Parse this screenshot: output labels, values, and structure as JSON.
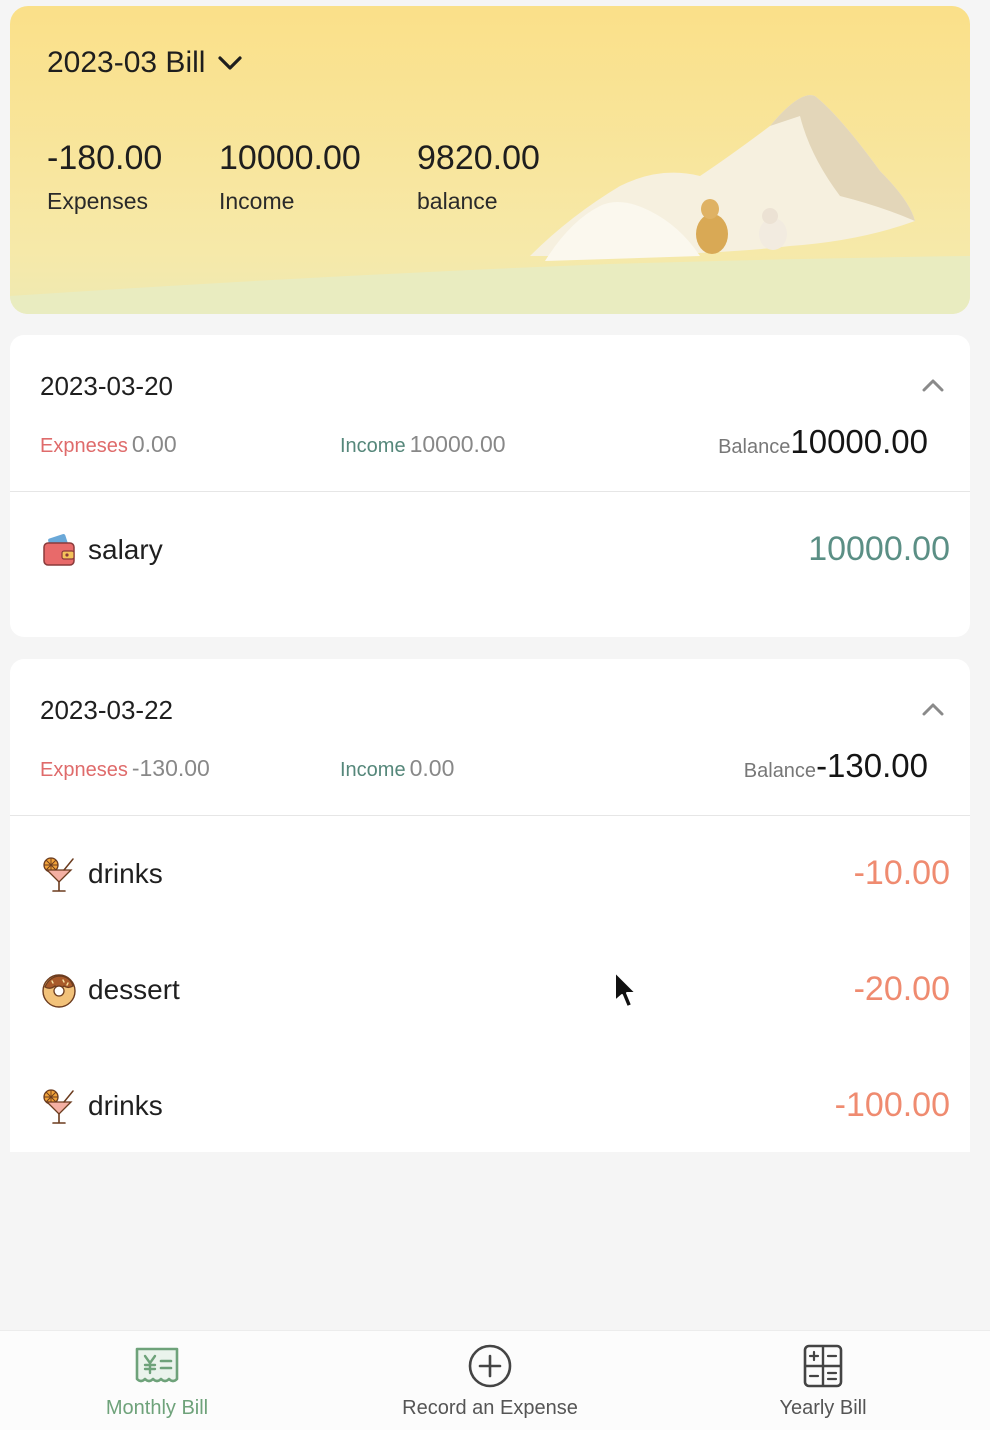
{
  "summary": {
    "month_title": "2023-03 Bill",
    "expenses_value": "-180.00",
    "expenses_label": "Expenses",
    "income_value": "10000.00",
    "income_label": "Income",
    "balance_value": "9820.00",
    "balance_label": "balance"
  },
  "days": [
    {
      "date": "2023-03-20",
      "expense_label": "Expneses",
      "expense_value": "0.00",
      "income_label": "Income",
      "income_value": "10000.00",
      "balance_label": "Balance",
      "balance_value": "10000.00",
      "items": [
        {
          "icon": "wallet-icon",
          "name": "salary",
          "amount": "10000.00",
          "kind": "income"
        }
      ]
    },
    {
      "date": "2023-03-22",
      "expense_label": "Expneses",
      "expense_value": "-130.00",
      "income_label": "Income",
      "income_value": "0.00",
      "balance_label": "Balance",
      "balance_value": "-130.00",
      "items": [
        {
          "icon": "drink-icon",
          "name": "drinks",
          "amount": "-10.00",
          "kind": "expense"
        },
        {
          "icon": "donut-icon",
          "name": "dessert",
          "amount": "-20.00",
          "kind": "expense"
        },
        {
          "icon": "drink-icon",
          "name": "drinks",
          "amount": "-100.00",
          "kind": "expense"
        }
      ]
    }
  ],
  "tabbar": {
    "monthly_label": "Monthly Bill",
    "record_label": "Record an Expense",
    "yearly_label": "Yearly Bill"
  },
  "colors": {
    "income": "#5b8f85",
    "expense": "#ef8b70",
    "expense_label": "#df6b6b",
    "active_tab": "#6ea27a",
    "header_bg": "#fae089"
  }
}
